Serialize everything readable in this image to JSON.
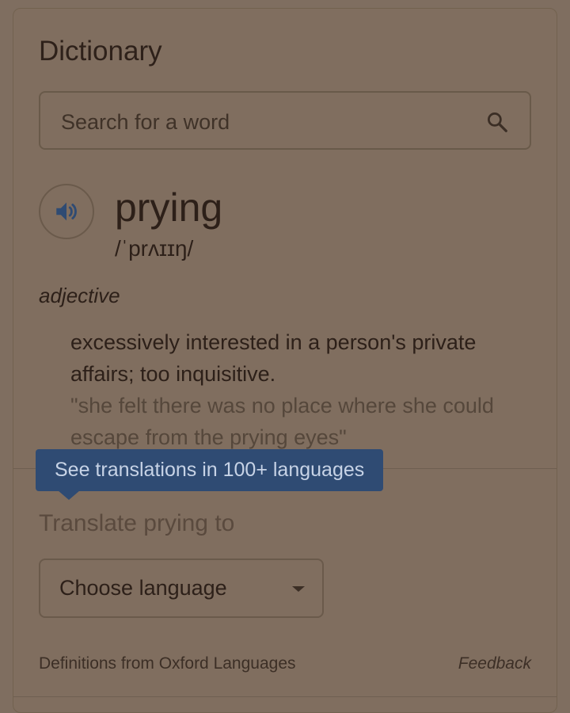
{
  "dictionary": {
    "title": "Dictionary",
    "search": {
      "placeholder": "Search for a word",
      "icon": "search-icon"
    },
    "entry": {
      "word": "prying",
      "phonetic": "/ˈprʌɪɪŋ/",
      "part_of_speech": "adjective",
      "definition": "excessively interested in a person's private affairs; too inquisitive.",
      "example": "\"she felt there was no place where she could escape from the prying eyes\""
    },
    "tooltip": "See translations in 100+ languages",
    "translate": {
      "label": "Translate prying to",
      "select_value": "Choose language"
    },
    "footer": {
      "source": "Definitions from Oxford Languages",
      "feedback": "Feedback"
    }
  },
  "colors": {
    "accent": "#2f4b73",
    "speaker_icon": "#2f4b73",
    "background": "#806e5f"
  }
}
